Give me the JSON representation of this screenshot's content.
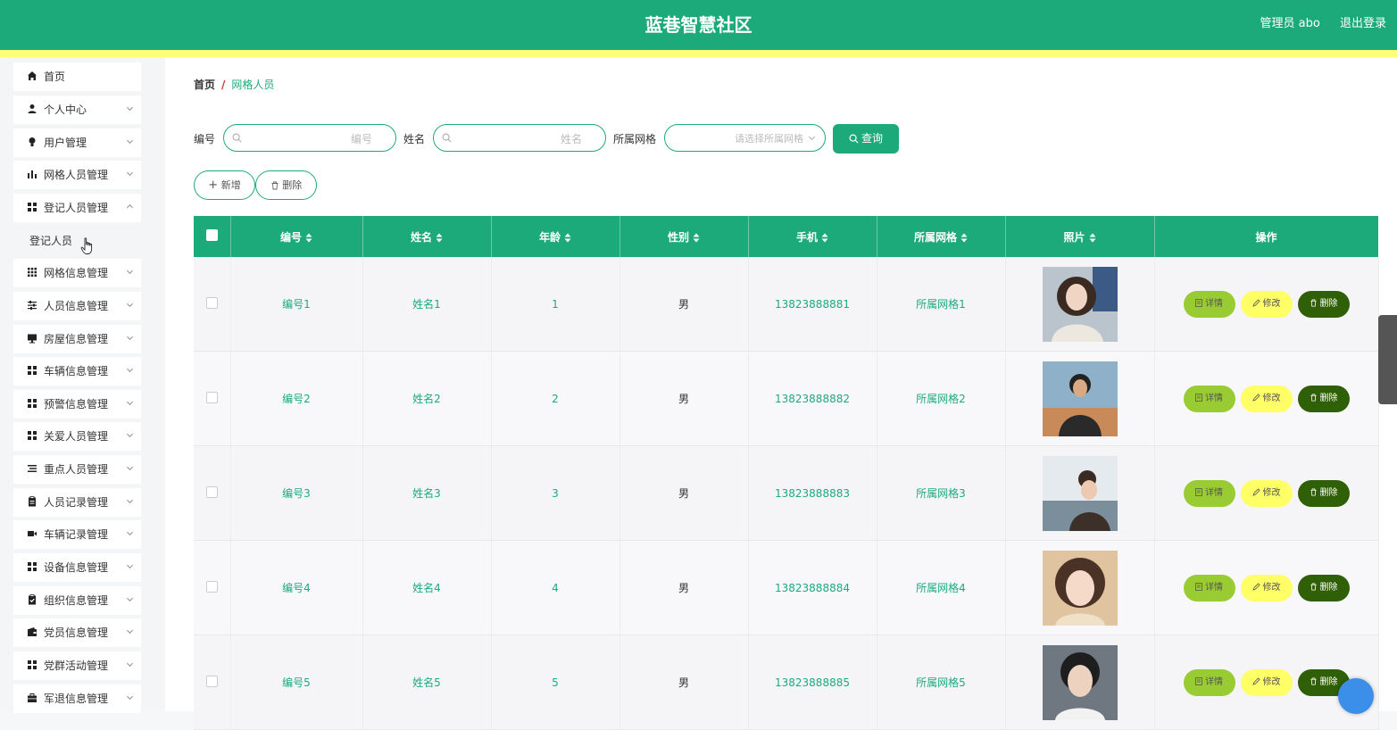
{
  "header": {
    "title": "蓝巷智慧社区",
    "user": "管理员 abo",
    "logout": "退出登录"
  },
  "sidebar": {
    "items": [
      {
        "label": "首页",
        "icon": "home-icon",
        "chevron": false
      },
      {
        "label": "个人中心",
        "icon": "person-icon",
        "chevron": true
      },
      {
        "label": "用户管理",
        "icon": "bulb-icon",
        "chevron": true
      },
      {
        "label": "网格人员管理",
        "icon": "bar-chart-icon",
        "chevron": true
      },
      {
        "label": "登记人员管理",
        "icon": "grid-icon",
        "chevron": true
      },
      {
        "label": "登记人员",
        "icon": "",
        "chevron": false,
        "submenu": true
      },
      {
        "label": "网格信息管理",
        "icon": "dots-grid-icon",
        "chevron": true
      },
      {
        "label": "人员信息管理",
        "icon": "sliders-icon",
        "chevron": true
      },
      {
        "label": "房屋信息管理",
        "icon": "monitor-icon",
        "chevron": true
      },
      {
        "label": "车辆信息管理",
        "icon": "grid-icon",
        "chevron": true
      },
      {
        "label": "预警信息管理",
        "icon": "grid-icon",
        "chevron": true
      },
      {
        "label": "关爱人员管理",
        "icon": "grid-icon",
        "chevron": true
      },
      {
        "label": "重点人员管理",
        "icon": "list-icon",
        "chevron": true
      },
      {
        "label": "人员记录管理",
        "icon": "clipboard-icon",
        "chevron": true
      },
      {
        "label": "车辆记录管理",
        "icon": "video-icon",
        "chevron": true
      },
      {
        "label": "设备信息管理",
        "icon": "grid-icon",
        "chevron": true
      },
      {
        "label": "组织信息管理",
        "icon": "clipboard-check-icon",
        "chevron": true
      },
      {
        "label": "党员信息管理",
        "icon": "wallet-icon",
        "chevron": true
      },
      {
        "label": "党群活动管理",
        "icon": "grid-icon",
        "chevron": true
      },
      {
        "label": "军退信息管理",
        "icon": "briefcase-icon",
        "chevron": true
      }
    ]
  },
  "breadcrumb": {
    "home": "首页",
    "separator": "/",
    "current": "网格人员"
  },
  "search": {
    "bianhao_label": "编号",
    "bianhao_placeholder": "编号",
    "xingming_label": "姓名",
    "xingming_placeholder": "姓名",
    "wangge_label": "所属网格",
    "wangge_placeholder": "请选择所属网格",
    "query_label": "查询"
  },
  "actions": {
    "add_label": "新增",
    "delete_label": "删除"
  },
  "table": {
    "columns": [
      "编号",
      "姓名",
      "年龄",
      "性别",
      "手机",
      "所属网格",
      "照片",
      "操作"
    ],
    "rows": [
      {
        "id": "编号1",
        "name": "姓名1",
        "age": "1",
        "gender": "男",
        "phone": "13823888881",
        "grid": "所属网格1"
      },
      {
        "id": "编号2",
        "name": "姓名2",
        "age": "2",
        "gender": "男",
        "phone": "13823888882",
        "grid": "所属网格2"
      },
      {
        "id": "编号3",
        "name": "姓名3",
        "age": "3",
        "gender": "男",
        "phone": "13823888883",
        "grid": "所属网格3"
      },
      {
        "id": "编号4",
        "name": "姓名4",
        "age": "4",
        "gender": "男",
        "phone": "13823888884",
        "grid": "所属网格4"
      },
      {
        "id": "编号5",
        "name": "姓名5",
        "age": "5",
        "gender": "男",
        "phone": "13823888885",
        "grid": "所属网格5"
      }
    ],
    "row_actions": {
      "detail": "详情",
      "edit": "修改",
      "delete": "删除"
    }
  },
  "colors": {
    "primary": "#1daa7b",
    "accent_strip": "#ffff77",
    "detail_btn": "#99cc33",
    "edit_btn": "#ffff66",
    "delete_btn": "#2f5f06"
  }
}
